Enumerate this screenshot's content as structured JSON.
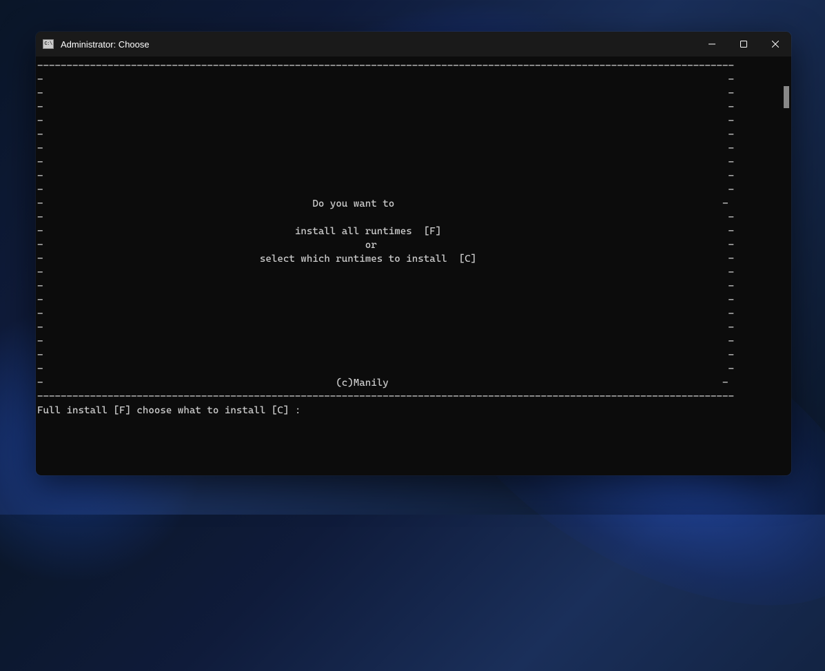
{
  "window": {
    "title": "Administrator:  Choose",
    "icon_label": "C:\\"
  },
  "terminal": {
    "box_top": "-----------------------------------------------------------------------------------------------------------------------",
    "box_side_l": "-",
    "box_side_r": "-",
    "line_prompt": "Do you want to",
    "line_option1": "install all runtimes  [F]",
    "line_or": "or",
    "line_option2": "select which runtimes to install  [C]",
    "line_copyright": "(c)Manily",
    "box_bottom": "-----------------------------------------------------------------------------------------------------------------------",
    "input_prompt": "Full install [F] choose what to install [C] :"
  }
}
